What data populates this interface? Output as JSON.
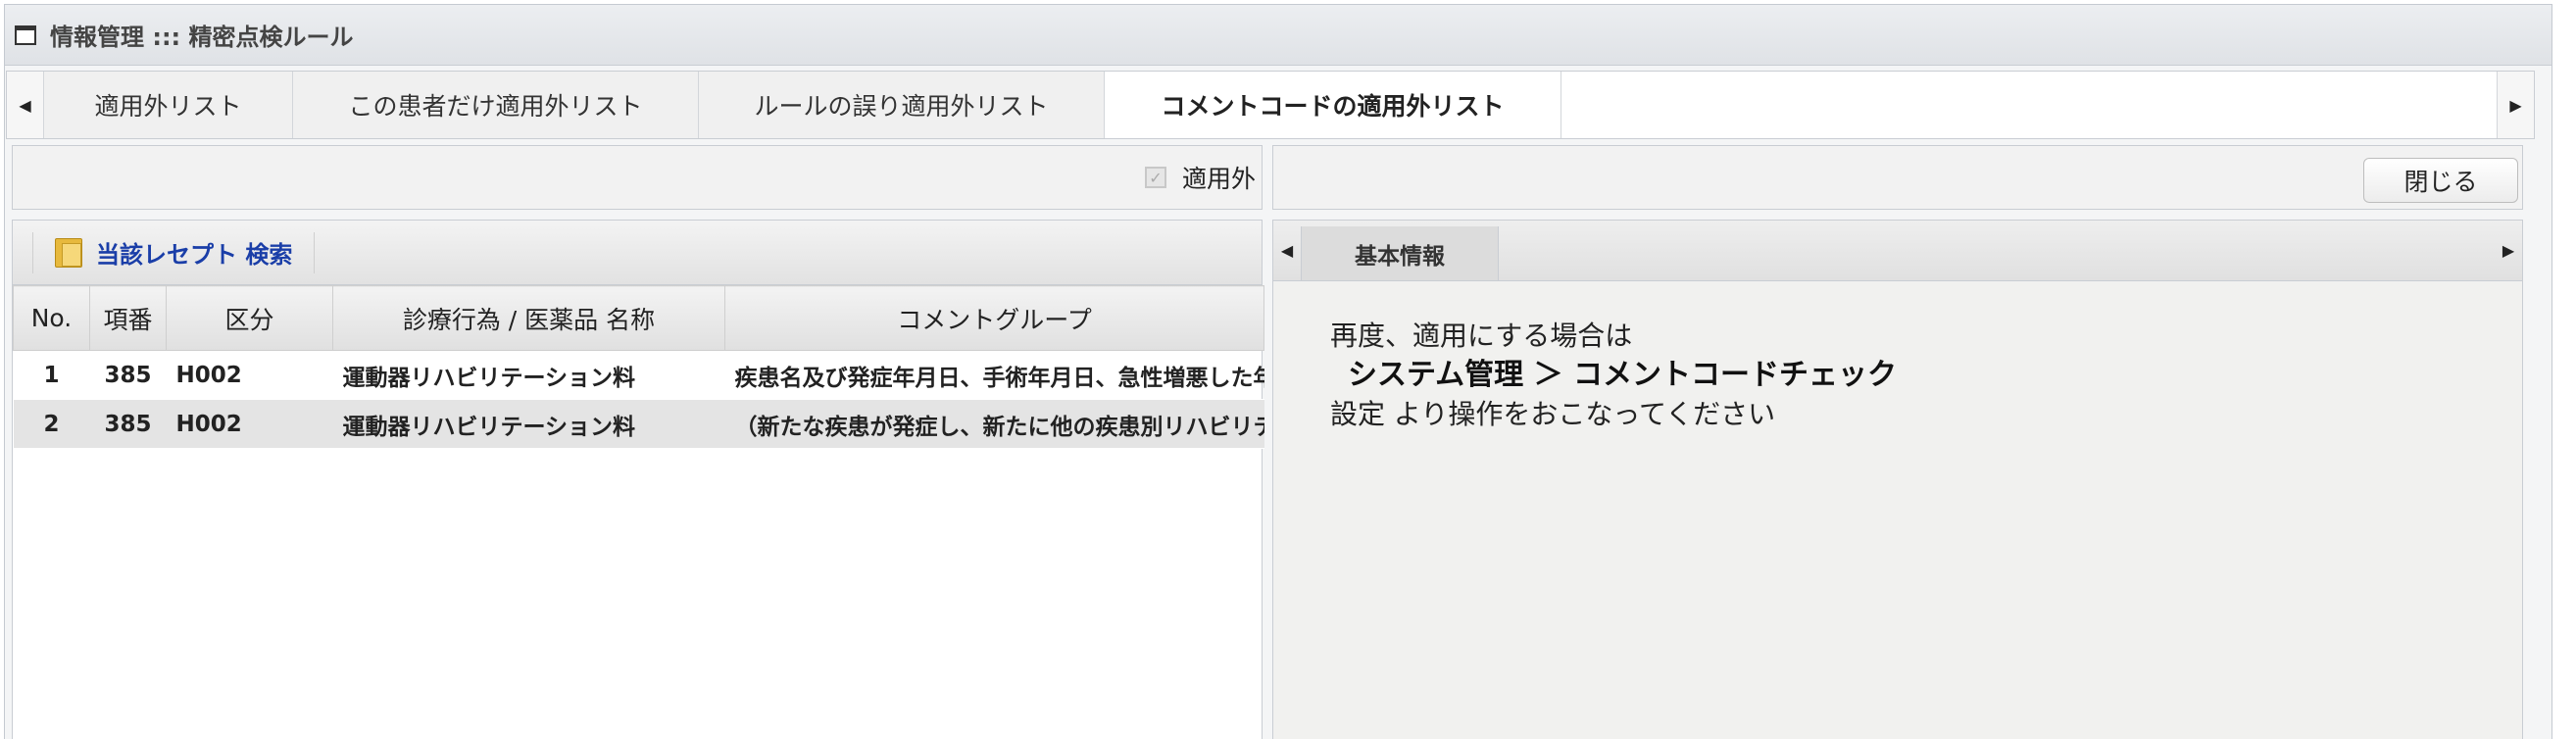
{
  "window": {
    "title": "情報管理 ::: 精密点検ルール"
  },
  "tabs": [
    {
      "label": "適用外リスト",
      "active": false
    },
    {
      "label": "この患者だけ適用外リスト",
      "active": false
    },
    {
      "label": "ルールの誤り適用外リスト",
      "active": false
    },
    {
      "label": "コメントコードの適用外リスト",
      "active": true
    }
  ],
  "left": {
    "toolbar": {
      "checkbox_label": "適用外",
      "checked": true
    },
    "search_label": "当該レセプト 検索",
    "columns": [
      "No.",
      "項番",
      "区分",
      "診療行為 / 医薬品 名称",
      "コメントグループ"
    ],
    "rows": [
      [
        "1",
        "385",
        "H002",
        "運動器リハビリテーション料",
        "疾患名及び発症年月日、手術年月日、急性増悪した年月日"
      ],
      [
        "2",
        "385",
        "H002",
        "運動器リハビリテーション料",
        "（新たな疾患が発症し、新たに他の疾患別リハビリテーション"
      ]
    ]
  },
  "right": {
    "close_label": "閉じる",
    "inner_tab": "基本情報",
    "message": {
      "line1": "再度、適用にする場合は",
      "path": "システム管理 ＞ コメントコードチェック",
      "line3": "設定 より操作をおこなってください"
    }
  },
  "icons": {
    "tab_left": "◀",
    "tab_right": "▶",
    "check": "✓"
  }
}
